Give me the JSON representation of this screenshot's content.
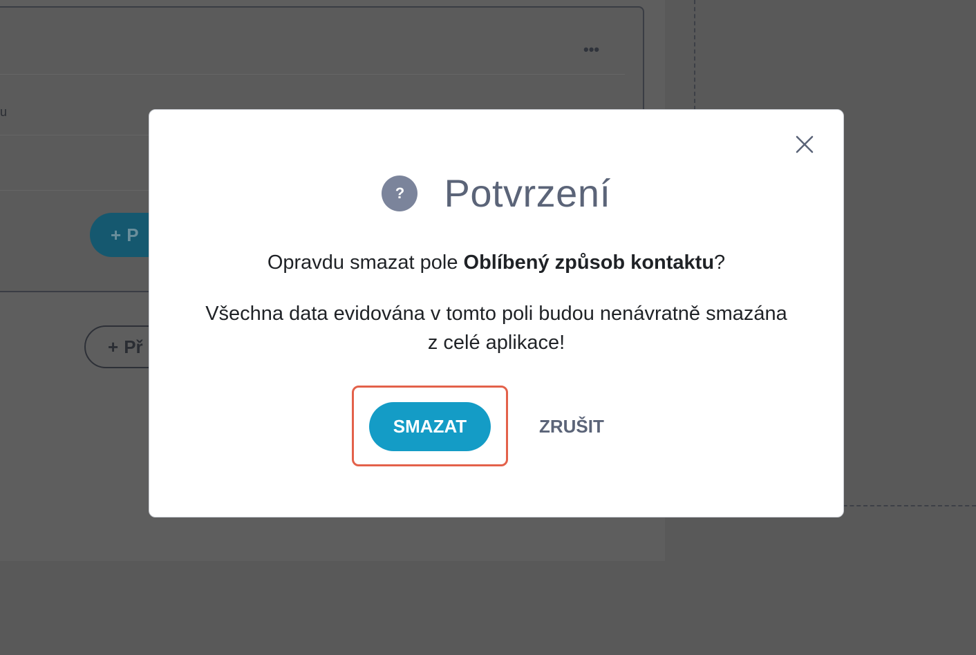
{
  "background": {
    "menu_icon": "more-horizontal-icon",
    "menu_glyph": "•••",
    "field_label_fragment": "u",
    "add_button_glyph": "+",
    "add_button_fragment": "P",
    "add_outline_button_glyph": "+",
    "add_outline_button_fragment": "Př"
  },
  "modal": {
    "icon": "question-circle-icon",
    "icon_glyph": "?",
    "title": "Potvrzení",
    "message_prefix": "Opravdu smazat pole ",
    "message_field_name": "Oblíbený způsob kontaktu",
    "message_suffix": "?",
    "warning_line1": "Všechna data evidována v tomto poli budou nenávratně smazána",
    "warning_line2": "z celé aplikace!",
    "confirm_label": "SMAZAT",
    "cancel_label": "ZRUŠIT",
    "close_icon": "close-icon",
    "highlight_color": "#e3614a",
    "accent_color": "#149cc6"
  }
}
